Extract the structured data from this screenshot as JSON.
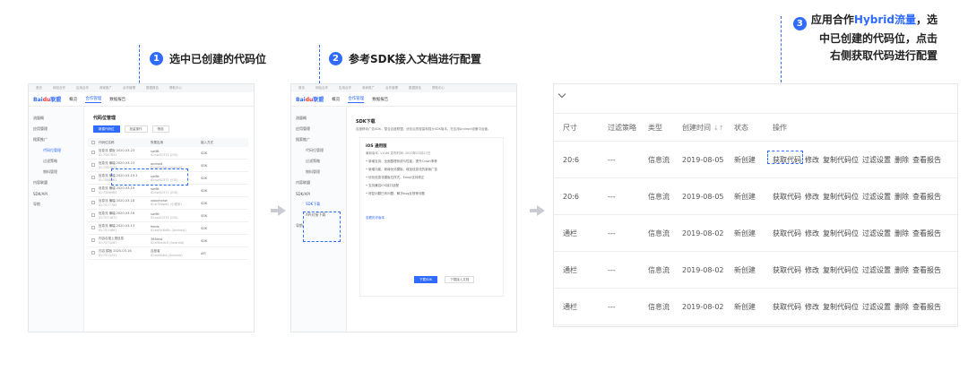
{
  "steps": {
    "step1": {
      "num": "1",
      "text": "选中已创建的代码位"
    },
    "step2": {
      "num": "2",
      "text": "参考SDK接入文档进行配置"
    },
    "step3": {
      "num": "3",
      "pre": "应用合作",
      "highlight": "Hybrid流量",
      "line1_tail": "，选",
      "line2": "中已创建的代码位，点击",
      "line3": "右侧获取代码进行配置"
    }
  },
  "colors": {
    "accent": "#2f6bff",
    "arrow": "#c9ccd3"
  },
  "shot1": {
    "topbar": [
      "首页",
      "网站合作",
      "应用合作",
      "商家推广",
      "合作管理",
      "数据报告",
      "帮助中心"
    ],
    "logo": {
      "main": "Bai",
      "accent": "du",
      "suffix": "联盟"
    },
    "nav": [
      "概览",
      "合作管理",
      "数据报告"
    ],
    "sidebar": [
      {
        "label": "流量概",
        "sub": false,
        "active": false
      },
      {
        "label": "应用管理",
        "sub": false,
        "active": false
      },
      {
        "label": "搜索推广",
        "sub": false,
        "active": false
      },
      {
        "label": "代码位管理",
        "sub": true,
        "active": true
      },
      {
        "label": "过滤策略",
        "sub": true,
        "active": false
      },
      {
        "label": "物料管理",
        "sub": true,
        "active": false
      },
      {
        "label": "内容联盟",
        "sub": false,
        "active": false
      },
      {
        "label": "SDK/API",
        "sub": false,
        "active": false
      },
      {
        "label": "导航",
        "sub": false,
        "active": false
      }
    ],
    "title": "代码位管理",
    "buttons": [
      "新建代码位",
      "批量操作",
      "筛选"
    ],
    "headers": [
      "代码位名称",
      "所属应用",
      "接入方式"
    ],
    "rows": [
      {
        "name": "信息流 模板 2020-03-23",
        "id": "ID:7587831",
        "app": "swiftt",
        "app_id": "ID:sw01371 (iOS)",
        "access": "SDK"
      },
      {
        "name": "信息流 横幅 2020-03-23",
        "id": "ID:7587831",
        "app": "android",
        "app_id": "ID:a09c8b (Android)",
        "access": "SDK"
      },
      {
        "name": "信息流 横幅 2020-03-19-1",
        "id": "ID:7586962",
        "app": "swiftt",
        "app_id": "ID:sw01371 (iOS)",
        "access": "SDK"
      },
      {
        "name": "信息流 横幅 2020-03-19",
        "id": "ID:7586960",
        "app": "swiftt",
        "app_id": "ID:sw01371 (iOS)",
        "access": "SDK"
      },
      {
        "name": "信息流 横幅 2020-03-18",
        "id": "ID:7577785",
        "app": "xiaochenw",
        "app_id": "ID:b786ad4 (小程序)",
        "access": "SDK"
      },
      {
        "name": "信息流 横幅 2020-03-18",
        "id": "ID:7574870",
        "app": "swiftt",
        "app_id": "ID:sw01371 (iOS)",
        "access": "SDK"
      },
      {
        "name": "信息流 横幅 2020-03-13",
        "id": "ID:7574867",
        "app": "feeds",
        "app_id": "ID:ed348d6c (Android)",
        "access": "SDK"
      },
      {
        "name": "内容合搜上搜信息",
        "id": "ID:7574287",
        "app": "365test",
        "app_id": "ID:e9bedc0 (Android)",
        "access": "SDK"
      },
      {
        "name": "内容 模板 2020-03-16",
        "id": "ID:7574241",
        "app": "百度者",
        "app_id": "ID:ed9bb4 (Android)",
        "access": "API"
      }
    ]
  },
  "shot2": {
    "topbar": [
      "首页",
      "网站合作",
      "应用合作",
      "商家推广",
      "合作管理",
      "数据报告",
      "帮助中心"
    ],
    "logo": {
      "main": "Bai",
      "accent": "du",
      "suffix": "联盟"
    },
    "nav": [
      "概览",
      "合作管理",
      "数据报告"
    ],
    "sidebar": [
      {
        "label": "流量概",
        "sub": false,
        "active": false
      },
      {
        "label": "应用管理",
        "sub": false,
        "active": false
      },
      {
        "label": "搜索推广",
        "sub": false,
        "active": false
      },
      {
        "label": "代码位管理",
        "sub": true,
        "active": false
      },
      {
        "label": "过滤策略",
        "sub": true,
        "active": false
      },
      {
        "label": "物料管理",
        "sub": true,
        "active": false
      },
      {
        "label": "内容联盟",
        "sub": false,
        "active": false
      },
      {
        "label": "SDK/API",
        "sub": false,
        "active": false
      },
      {
        "label": "SDK下载",
        "sub": true,
        "active": true
      },
      {
        "label": "API对接下载",
        "sub": true,
        "active": false
      },
      {
        "label": "导航",
        "sub": false,
        "active": false
      }
    ],
    "title": "SDK下载",
    "desc": "百度移动广告SDK，整合百度联盟，优化后的轻量和强大SDK版本，在应用Android设备中运营。",
    "sub_title": "iOS 通用版",
    "meta": "最新版本: V4.86      发布时间: 2020年03月27日",
    "bullets": [
      "• 新增支持，全面整理系统与性能，提升Crash率等",
      "• 新增功能，新增优化模板，增加信息流的新版广告",
      "• 优化信息流模板位样式，Emoji支持修正",
      "• 支持兼容iOS接口适配",
      "• 修复问题已有问题，解决bug反馈等问题"
    ],
    "link": "查看历史版本",
    "btn_primary": "下载SDK",
    "btn_secondary": "下载接入文档"
  },
  "panel": {
    "headers": {
      "size": "尺寸",
      "strategy": "过滤策略",
      "type": "类型",
      "time": "创建时间",
      "sort": "↓↑",
      "state": "状态",
      "ops": "操作"
    },
    "rows": [
      {
        "size": "20:6",
        "strategy": "---",
        "type": "信息流",
        "time": "2019-08-05",
        "state": "新创建"
      },
      {
        "size": "20:6",
        "strategy": "---",
        "type": "信息流",
        "time": "2019-08-05",
        "state": "新创建"
      },
      {
        "size": "通栏",
        "strategy": "---",
        "type": "信息流",
        "time": "2019-08-02",
        "state": "新创建"
      },
      {
        "size": "通栏",
        "strategy": "---",
        "type": "信息流",
        "time": "2019-08-02",
        "state": "新创建"
      },
      {
        "size": "通栏",
        "strategy": "---",
        "type": "信息流",
        "time": "2019-08-02",
        "state": "新创建"
      }
    ],
    "ops": [
      "获取代码",
      "修改",
      "复制代码位",
      "过滤设置",
      "删除",
      "查看报告"
    ]
  }
}
